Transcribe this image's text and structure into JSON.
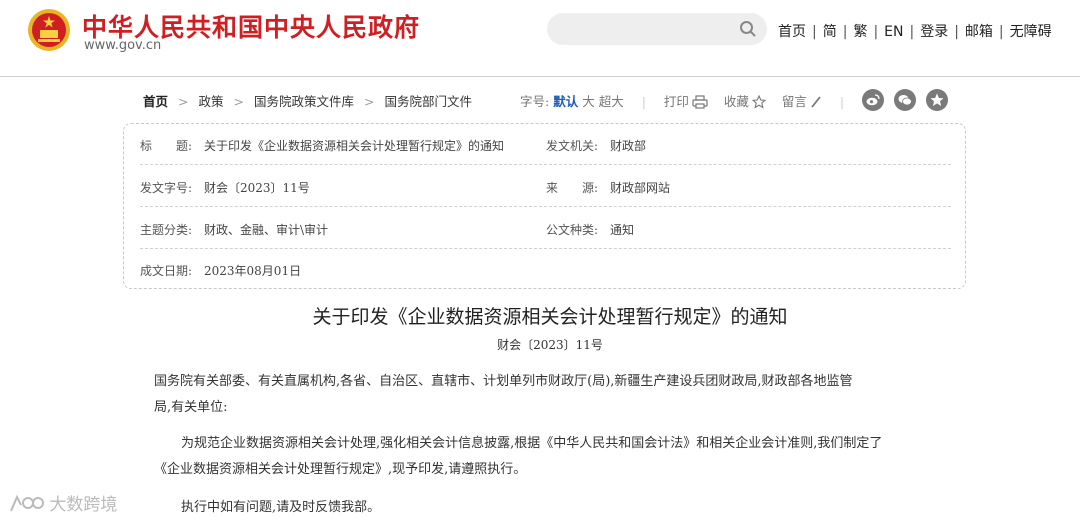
{
  "header": {
    "site_name": "中华人民共和国中央人民政府",
    "site_url": "www.gov.cn",
    "search_placeholder": "",
    "nav": [
      "首页",
      "简",
      "繁",
      "EN",
      "登录",
      "邮箱",
      "无障碍"
    ]
  },
  "breadcrumb": [
    "首页",
    "政策",
    "国务院政策文件库",
    "国务院部门文件"
  ],
  "toolbar": {
    "font_label": "字号:",
    "font_default": "默认",
    "font_large": "大",
    "font_xlarge": "超大",
    "print": "打印",
    "favorite": "收藏",
    "comment": "留言"
  },
  "share": [
    "weibo-icon",
    "wechat-icon",
    "favorite-star-icon"
  ],
  "info": {
    "title_label": "标　　题:",
    "title_value": "关于印发《企业数据资源相关会计处理暂行规定》的通知",
    "issuer_label": "发文机关:",
    "issuer_value": "财政部",
    "docno_label": "发文字号:",
    "docno_value": "财会〔2023〕11号",
    "source_label": "来　　源:",
    "source_value": "财政部网站",
    "topic_label": "主题分类:",
    "topic_value": "财政、金融、审计\\审计",
    "type_label": "公文种类:",
    "type_value": "通知",
    "date_label": "成文日期:",
    "date_value": "2023年08月01日"
  },
  "document": {
    "title": "关于印发《企业数据资源相关会计处理暂行规定》的通知",
    "number": "财会〔2023〕11号",
    "p1_line1": "国务院有关部委、有关直属机构,各省、自治区、直辖市、计划单列市财政厅(局),新疆生产建设兵团财政局,财政部各地监管",
    "p1_line2": "局,有关单位:",
    "p2_line1": "为规范企业数据资源相关会计处理,强化相关会计信息披露,根据《中华人民共和国会计法》和相关企业会计准则,我们制定了",
    "p2_line2": "《企业数据资源相关会计处理暂行规定》,现予印发,请遵照执行。",
    "p3_line1": "执行中如有问题,请及时反馈我部。"
  },
  "watermark": "大数跨境",
  "colors": {
    "brand_red": "#d01f22",
    "link_blue": "#1e5fb3"
  }
}
